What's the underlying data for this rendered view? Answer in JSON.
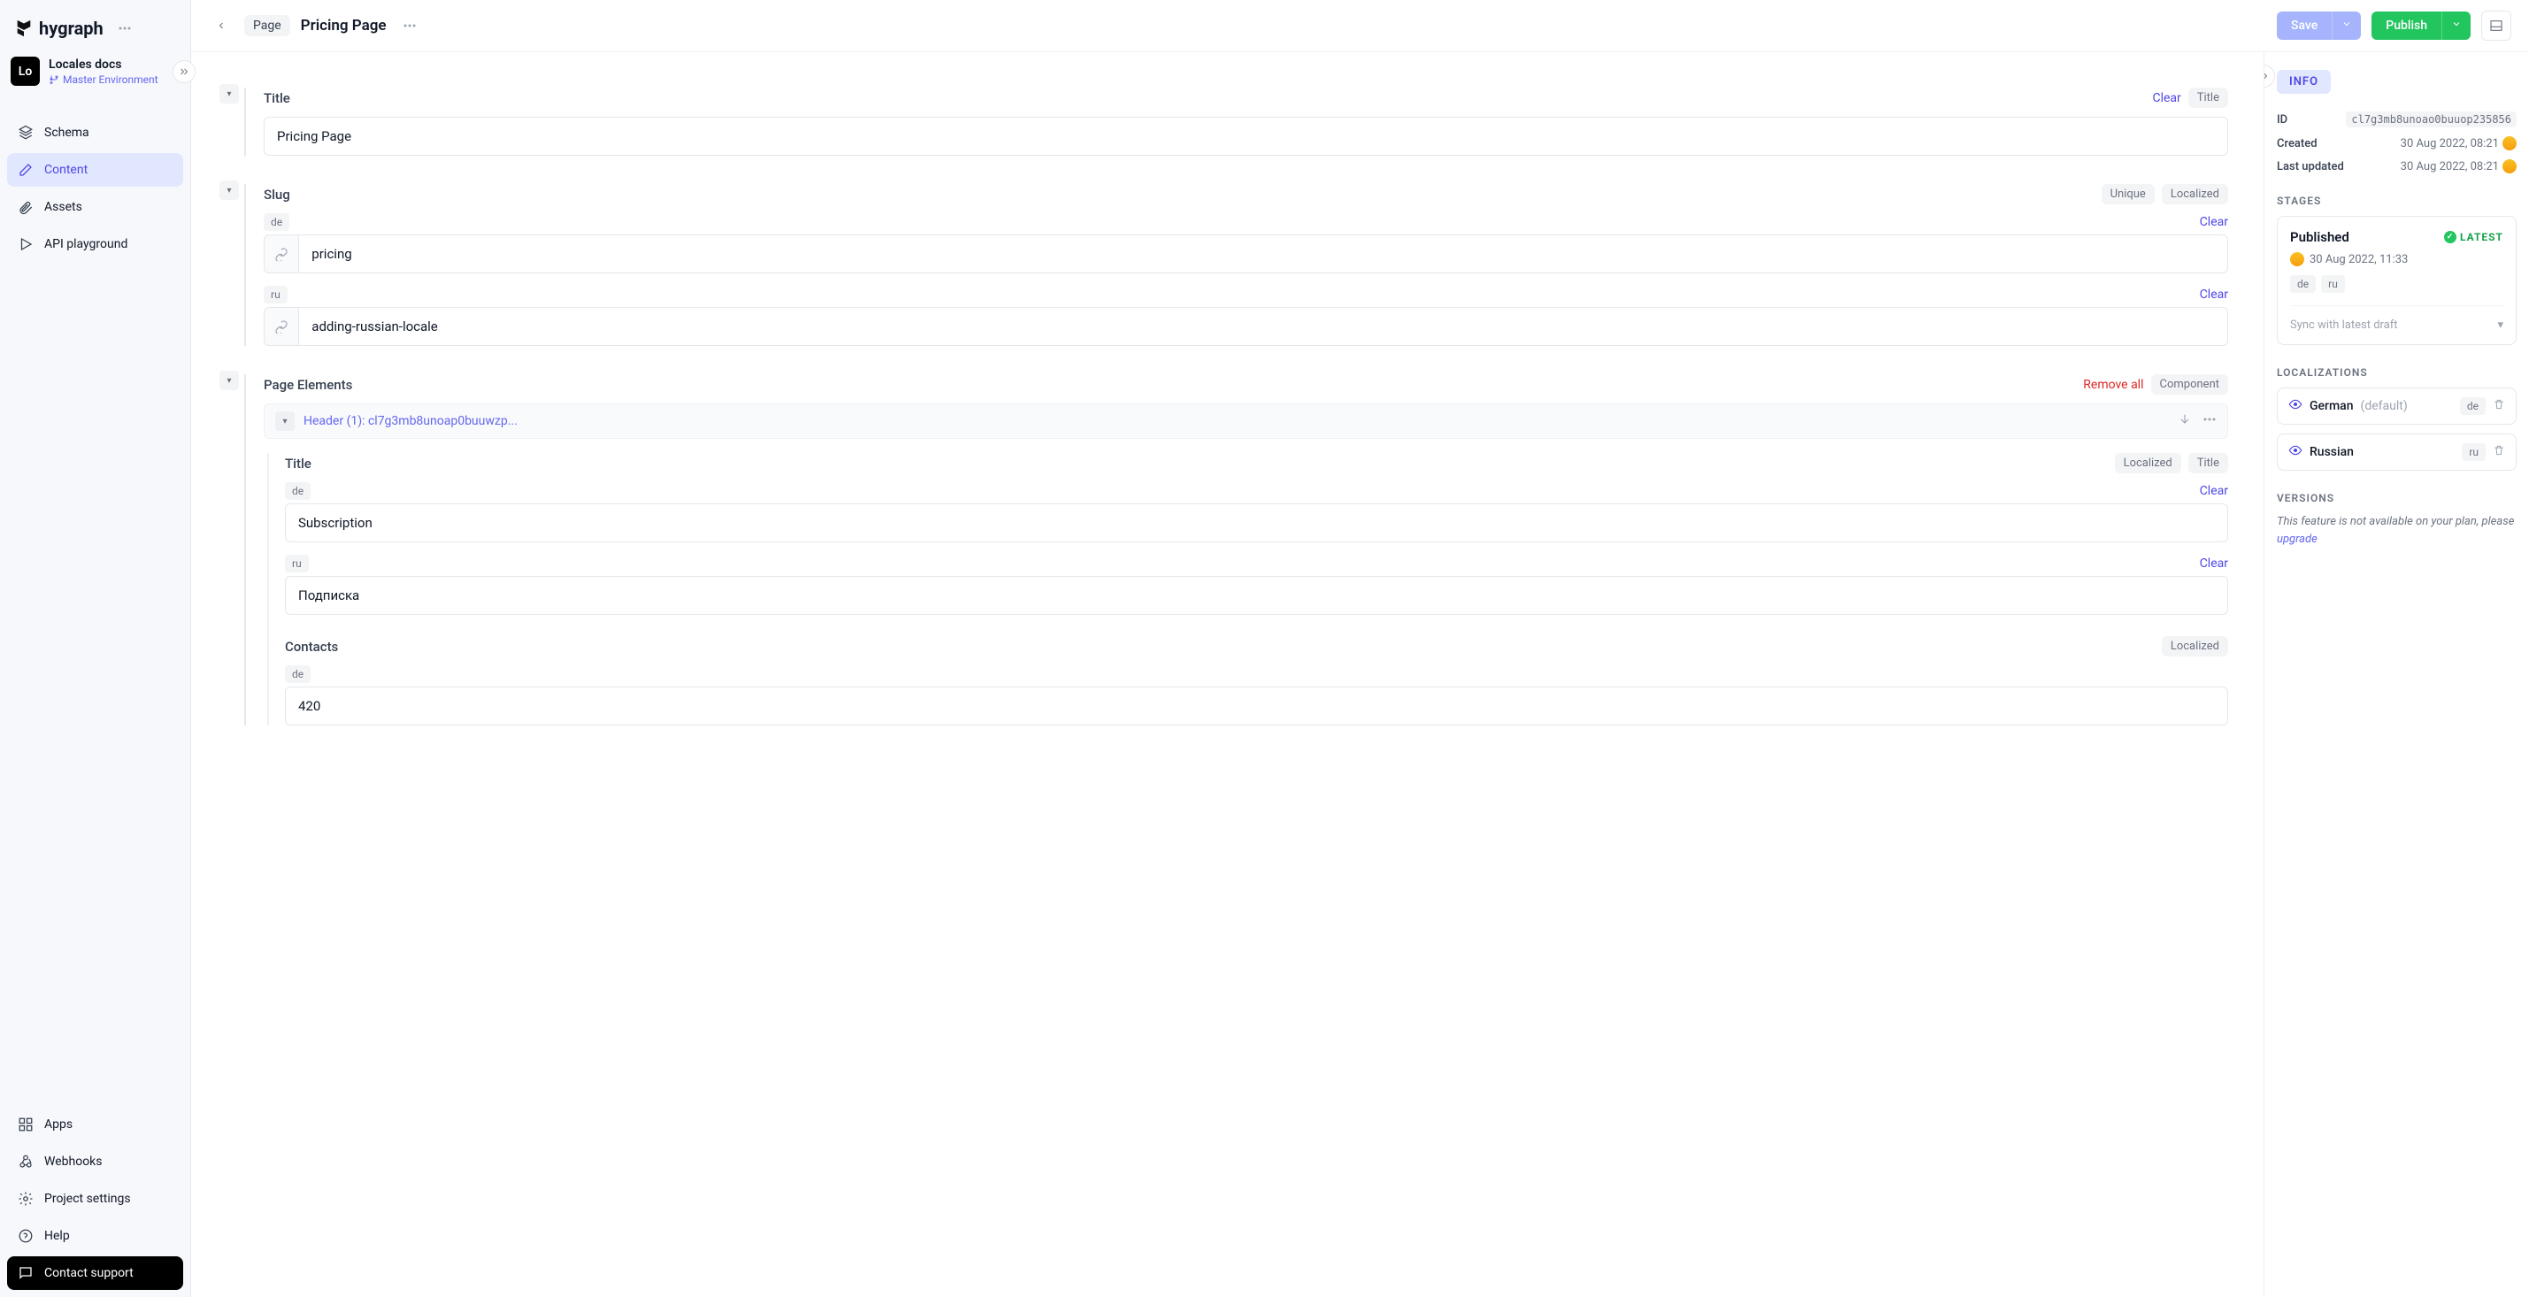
{
  "brand": "hygraph",
  "project": {
    "badge": "Lo",
    "name": "Locales docs",
    "environment": "Master Environment"
  },
  "nav": {
    "schema": "Schema",
    "content": "Content",
    "assets": "Assets",
    "api": "API playground",
    "apps": "Apps",
    "webhooks": "Webhooks",
    "settings": "Project settings",
    "help": "Help",
    "support": "Contact support"
  },
  "header": {
    "crumb_type": "Page",
    "title": "Pricing Page",
    "save": "Save",
    "publish": "Publish"
  },
  "fields": {
    "title": {
      "label": "Title",
      "clear": "Clear",
      "badge": "Title",
      "value": "Pricing Page"
    },
    "slug": {
      "label": "Slug",
      "unique_badge": "Unique",
      "localized_badge": "Localized",
      "de_chip": "de",
      "de_clear": "Clear",
      "de_value": "pricing",
      "ru_chip": "ru",
      "ru_clear": "Clear",
      "ru_value": "adding-russian-locale"
    },
    "page_elements": {
      "label": "Page Elements",
      "remove_all": "Remove all",
      "component_badge": "Component",
      "header_component": {
        "title": "Header (1): cl7g3mb8unoap0buuwzp...",
        "title_field": {
          "label": "Title",
          "localized_badge": "Localized",
          "title_badge": "Title",
          "de_chip": "de",
          "de_clear": "Clear",
          "de_value": "Subscription",
          "ru_chip": "ru",
          "ru_clear": "Clear",
          "ru_value": "Подписка"
        },
        "contacts_field": {
          "label": "Contacts",
          "localized_badge": "Localized",
          "de_chip": "de",
          "de_value": "420"
        }
      }
    }
  },
  "info": {
    "heading": "INFO",
    "id_label": "ID",
    "id_value": "cl7g3mb8unoao0buuop235856",
    "created_label": "Created",
    "created_value": "30 Aug 2022, 08:21",
    "updated_label": "Last updated",
    "updated_value": "30 Aug 2022, 08:21",
    "stages_heading": "STAGES",
    "stage": {
      "name": "Published",
      "latest": "LATEST",
      "timestamp": "30 Aug 2022, 11:33",
      "de_chip": "de",
      "ru_chip": "ru",
      "sync": "Sync with latest draft"
    },
    "localizations_heading": "LOCALIZATIONS",
    "loc_german": "German",
    "loc_default": "(default)",
    "loc_german_code": "de",
    "loc_russian": "Russian",
    "loc_russian_code": "ru",
    "versions_heading": "VERSIONS",
    "versions_note": "This feature is not available on your plan, please ",
    "upgrade": "upgrade"
  }
}
